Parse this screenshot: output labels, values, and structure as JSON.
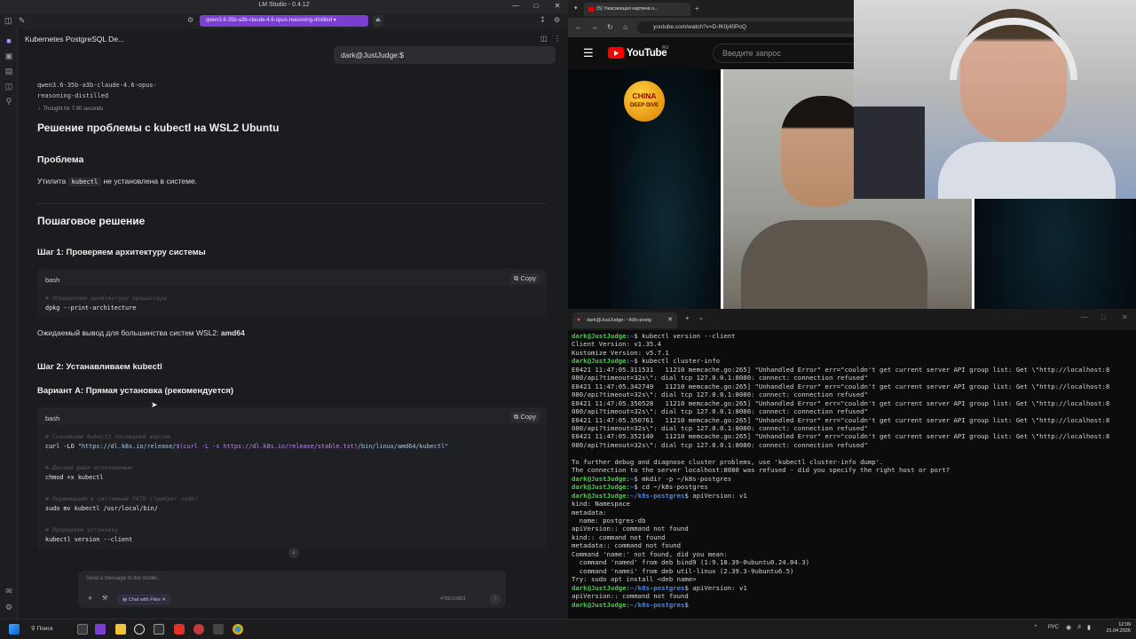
{
  "lmstudio": {
    "window_title": "LM Studio - 0.4.12",
    "model_pill": "qwen3.6-35b-a3b-claude-4.6-opus-reasoning-distilled",
    "chat_title": "Kubernetes PostgreSQL De...",
    "user_message": "dark@JustJudge:$",
    "model_name": "qwen3.6-35b-a3b-claude-4.6-opus-reasoning-distilled",
    "thought": "Thought for 7.90 seconds",
    "heading_main": "Решение проблемы с kubectl на WSL2 Ubuntu",
    "heading_problem": "Проблема",
    "problem_pre": "Утилита",
    "problem_code": "kubectl",
    "problem_post": "не установлена в системе.",
    "heading_steps": "Пошаговое решение",
    "step1_heading": "Шаг 1: Проверяем архитектуру системы",
    "code1": {
      "lang": "bash",
      "copy": "Copy",
      "comment": "# Определяем архитектуру процессора",
      "line": "dpkg --print-architecture"
    },
    "expected_pre": "Ожидаемый вывод для большинства систем WSL2:",
    "expected_bold": "amd64",
    "step2_heading": "Шаг 2: Устанавливаем kubectl",
    "variant_a": "Вариант А: Прямая установка (рекомендуется)",
    "code2": {
      "lang": "bash",
      "copy": "Copy",
      "c1": "# Скачиваем kubectl последней версии",
      "l1_a": "curl -LO ",
      "l1_b": "\"https://dl.k8s.io/release/",
      "l1_c": "$(curl -L -s https://dl.k8s.io/release/stable.txt)",
      "l1_d": "/bin/linux/amd64/kubectl\"",
      "c2": "# Делаем файл исполняемым",
      "l2": "chmod +x kubectl",
      "c3": "# Перемещаем в системный PATH (требует sudo)",
      "l3": "sudo mv kubectl /usr/local/bin/",
      "c4": "# Проверяем установку",
      "l4": "kubectl version --client"
    },
    "composer_placeholder": "Send a message to the model...",
    "chat_with_files": "Chat with Files",
    "token_count": "4755/119821"
  },
  "browser": {
    "tab_title": "(5) Ужасающая картина н...",
    "url": "youtube.com/watch?v=D-fK0j40PoQ",
    "yt_logo_text": "YouTube",
    "yt_region": "RU",
    "search_placeholder": "Введите запрос",
    "badge_line1": "CHINA",
    "badge_line2": "DEEP DIVE"
  },
  "terminal": {
    "tab_title": "dark@JustJudge: ~/k8s-postg",
    "lines": [
      {
        "p": "dark@JustJudge",
        "path": "~",
        "cmd": "kubectl version --client"
      },
      {
        "o": "Client Version: v1.35.4"
      },
      {
        "o": "Kustomize Version: v5.7.1"
      },
      {
        "p": "dark@JustJudge",
        "path": "~",
        "cmd": "kubectl cluster-info"
      },
      {
        "o": "E0421 11:47:05.311531   11210 memcache.go:265] \"Unhandled Error\" err=\"couldn't get current server API group list: Get \\\"http://localhost:8"
      },
      {
        "o": "080/api?timeout=32s\\\": dial tcp 127.0.0.1:8080: connect: connection refused\""
      },
      {
        "o": "E0421 11:47:05.342749   11210 memcache.go:265] \"Unhandled Error\" err=\"couldn't get current server API group list: Get \\\"http://localhost:8"
      },
      {
        "o": "080/api?timeout=32s\\\": dial tcp 127.0.0.1:8080: connect: connection refused\""
      },
      {
        "o": "E0421 11:47:05.350528   11210 memcache.go:265] \"Unhandled Error\" err=\"couldn't get current server API group list: Get \\\"http://localhost:8"
      },
      {
        "o": "080/api?timeout=32s\\\": dial tcp 127.0.0.1:8080: connect: connection refused\""
      },
      {
        "o": "E0421 11:47:05.350761   11210 memcache.go:265] \"Unhandled Error\" err=\"couldn't get current server API group list: Get \\\"http://localhost:8"
      },
      {
        "o": "080/api?timeout=32s\\\": dial tcp 127.0.0.1:8080: connect: connection refused\""
      },
      {
        "o": "E0421 11:47:05.352140   11210 memcache.go:265] \"Unhandled Error\" err=\"couldn't get current server API group list: Get \\\"http://localhost:8"
      },
      {
        "o": "080/api?timeout=32s\\\": dial tcp 127.0.0.1:8080: connect: connection refused\""
      },
      {
        "o": " "
      },
      {
        "o": "To further debug and diagnose cluster problems, use 'kubectl cluster-info dump'."
      },
      {
        "o": "The connection to the server localhost:8080 was refused - did you specify the right host or port?"
      },
      {
        "p": "dark@JustJudge",
        "path": "~",
        "cmd": "mkdir -p ~/k8s-postgres"
      },
      {
        "p": "dark@JustJudge",
        "path": "~",
        "cmd": "cd ~/k8s-postgres"
      },
      {
        "p": "dark@JustJudge",
        "path": "~/k8s-postgres",
        "cmd": "apiVersion: v1"
      },
      {
        "o": "kind: Namespace"
      },
      {
        "o": "metadata:"
      },
      {
        "o": "  name: postgres-db"
      },
      {
        "o": "apiVersion:: command not found"
      },
      {
        "o": "kind:: command not found"
      },
      {
        "o": "metadata:: command not found"
      },
      {
        "o": "Command 'name:' not found, did you mean:"
      },
      {
        "o": "  command 'named' from deb bind9 (1:9.18.39-0ubuntu0.24.04.3)"
      },
      {
        "o": "  command 'namei' from deb util-linux (2.39.3-9ubuntu6.5)"
      },
      {
        "o": "Try: sudo apt install <deb name>"
      },
      {
        "p": "dark@JustJudge",
        "path": "~/k8s-postgres",
        "cmd": "apiVersion: v1"
      },
      {
        "o": "apiVersion:: command not found"
      },
      {
        "p": "dark@JustJudge",
        "path": "~/k8s-postgres",
        "cmd": ""
      }
    ]
  },
  "taskbar": {
    "search": "Поиск",
    "lang": "РУС",
    "time": "12:09",
    "date": "21.04.2026"
  },
  "colors": {
    "accent_purple": "#7a3fd0",
    "prompt_green": "#4ec94e",
    "prompt_blue": "#4a86e8",
    "youtube_red": "#ff0000"
  }
}
